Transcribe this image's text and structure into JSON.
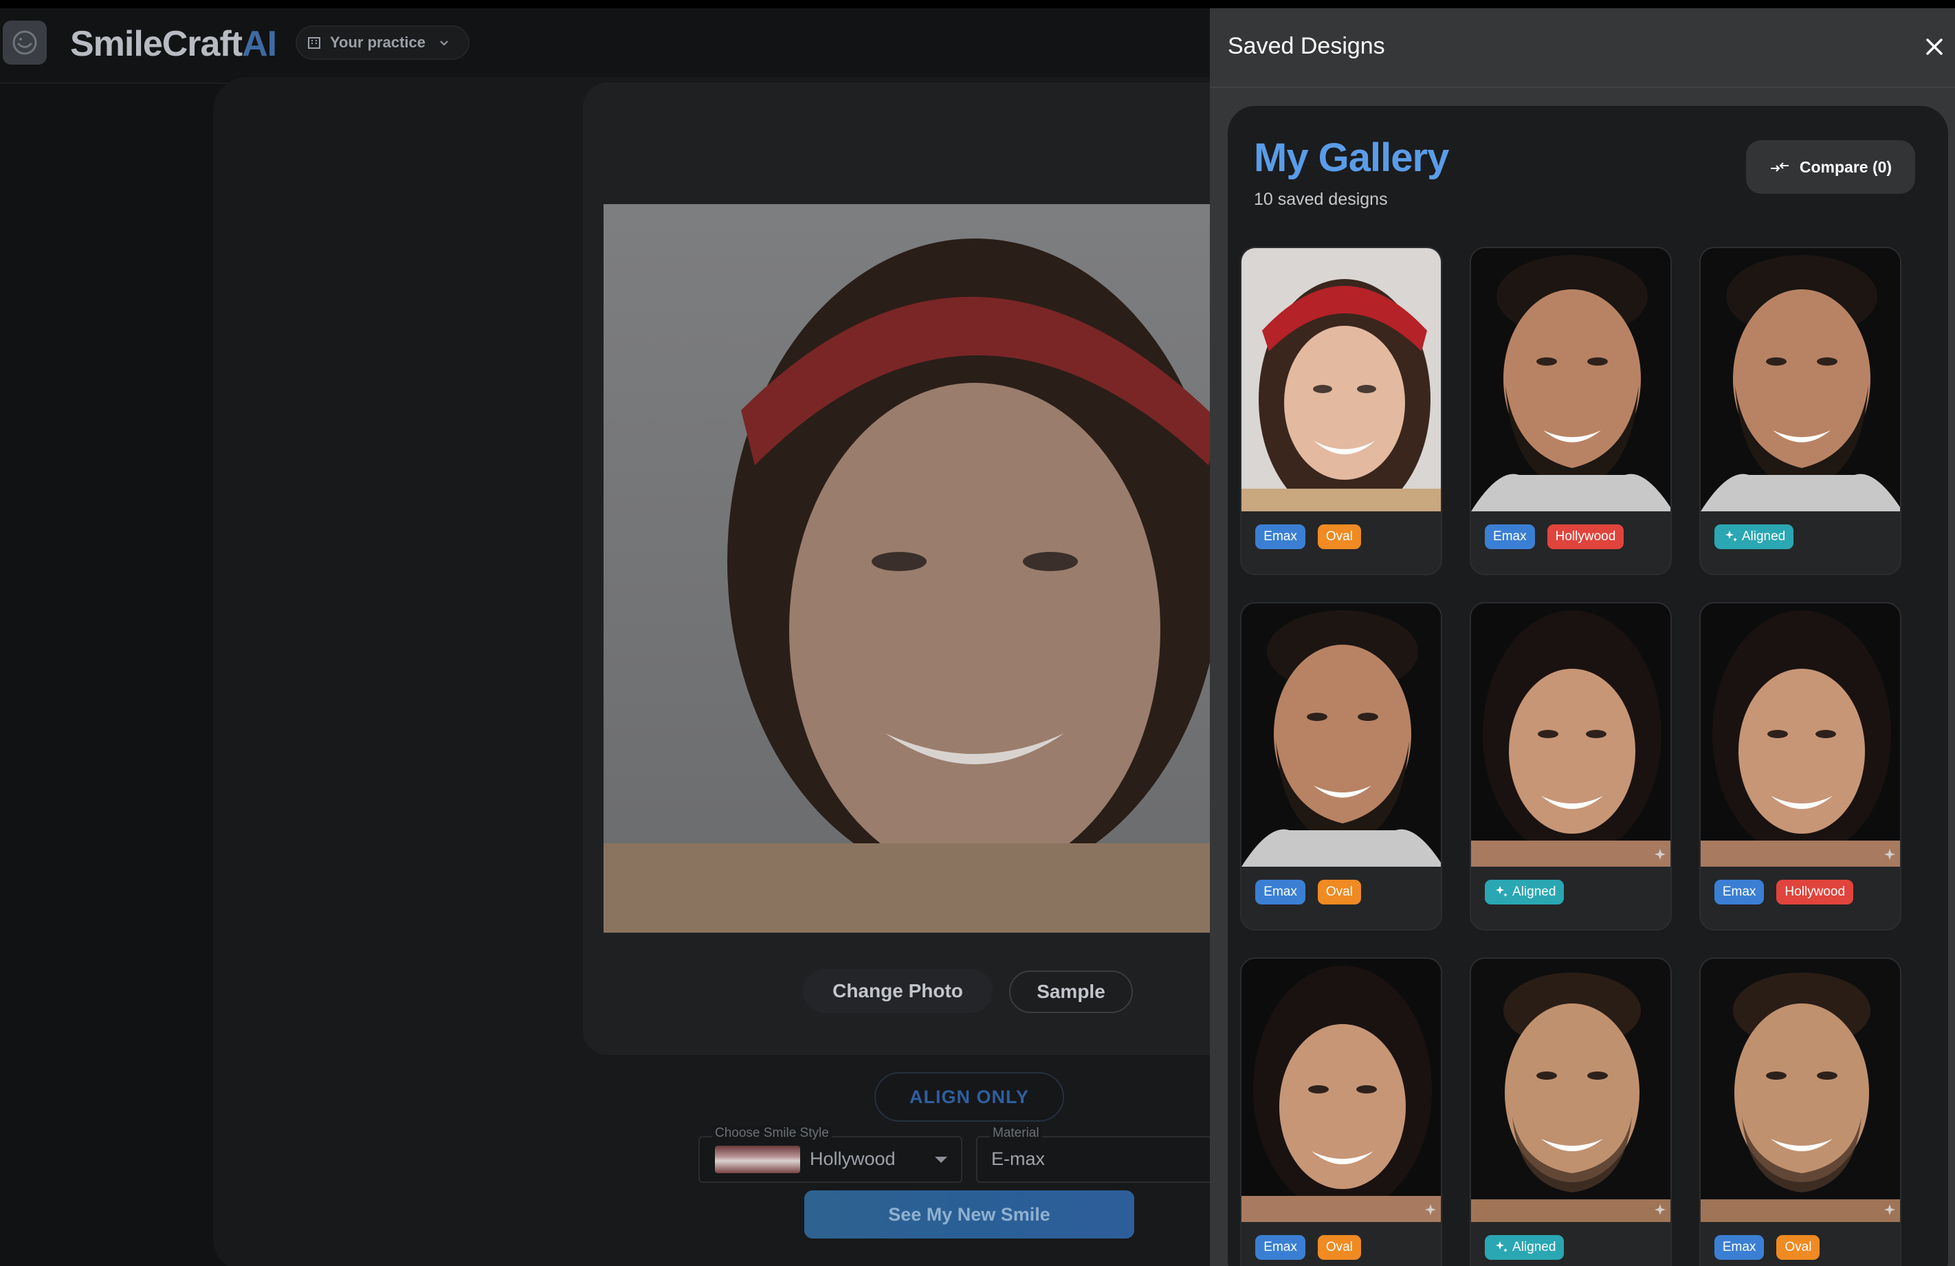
{
  "app": {
    "brand_name": "SmileCraft",
    "brand_suffix": "AI",
    "practice_selector": "Your practice",
    "change_photo_label": "Change Photo",
    "sample_label": "Sample",
    "align_only_label": "ALIGN ONLY",
    "smile_style_label": "Choose Smile Style",
    "smile_style_value": "Hollywood",
    "material_label": "Material",
    "material_value": "E-max",
    "see_smile_label": "See My New Smile"
  },
  "drawer": {
    "title": "Saved Designs",
    "gallery_title": "My Gallery",
    "saved_count": "10 saved designs",
    "compare_label": "Compare (0)"
  },
  "colors": {
    "emax": "#3b7fd4",
    "oval": "#f08a22",
    "hollywood": "#e0443c",
    "aligned": "#2aa7b3",
    "gallery_title": "#5a9ce8"
  },
  "designs": [
    {
      "subject": "woman-bandana",
      "tags": [
        {
          "label": "Emax",
          "kind": "emax"
        },
        {
          "label": "Oval",
          "kind": "oval"
        }
      ]
    },
    {
      "subject": "man-beard",
      "tags": [
        {
          "label": "Emax",
          "kind": "emax"
        },
        {
          "label": "Hollywood",
          "kind": "hollywood"
        }
      ]
    },
    {
      "subject": "man-beard",
      "tags": [
        {
          "label": "Aligned",
          "kind": "aligned"
        }
      ]
    },
    {
      "subject": "man-beard",
      "tags": [
        {
          "label": "Emax",
          "kind": "emax"
        },
        {
          "label": "Oval",
          "kind": "oval"
        }
      ]
    },
    {
      "subject": "woman-dark-hair",
      "tags": [
        {
          "label": "Aligned",
          "kind": "aligned"
        }
      ]
    },
    {
      "subject": "woman-dark-hair",
      "tags": [
        {
          "label": "Emax",
          "kind": "emax"
        },
        {
          "label": "Hollywood",
          "kind": "hollywood"
        }
      ]
    },
    {
      "subject": "woman-dark-hair",
      "tags": [
        {
          "label": "Emax",
          "kind": "emax"
        },
        {
          "label": "Oval",
          "kind": "oval"
        }
      ]
    },
    {
      "subject": "man-short-hair",
      "tags": [
        {
          "label": "Aligned",
          "kind": "aligned"
        }
      ]
    },
    {
      "subject": "man-short-hair",
      "tags": [
        {
          "label": "Emax",
          "kind": "emax"
        },
        {
          "label": "Oval",
          "kind": "oval"
        }
      ]
    }
  ]
}
